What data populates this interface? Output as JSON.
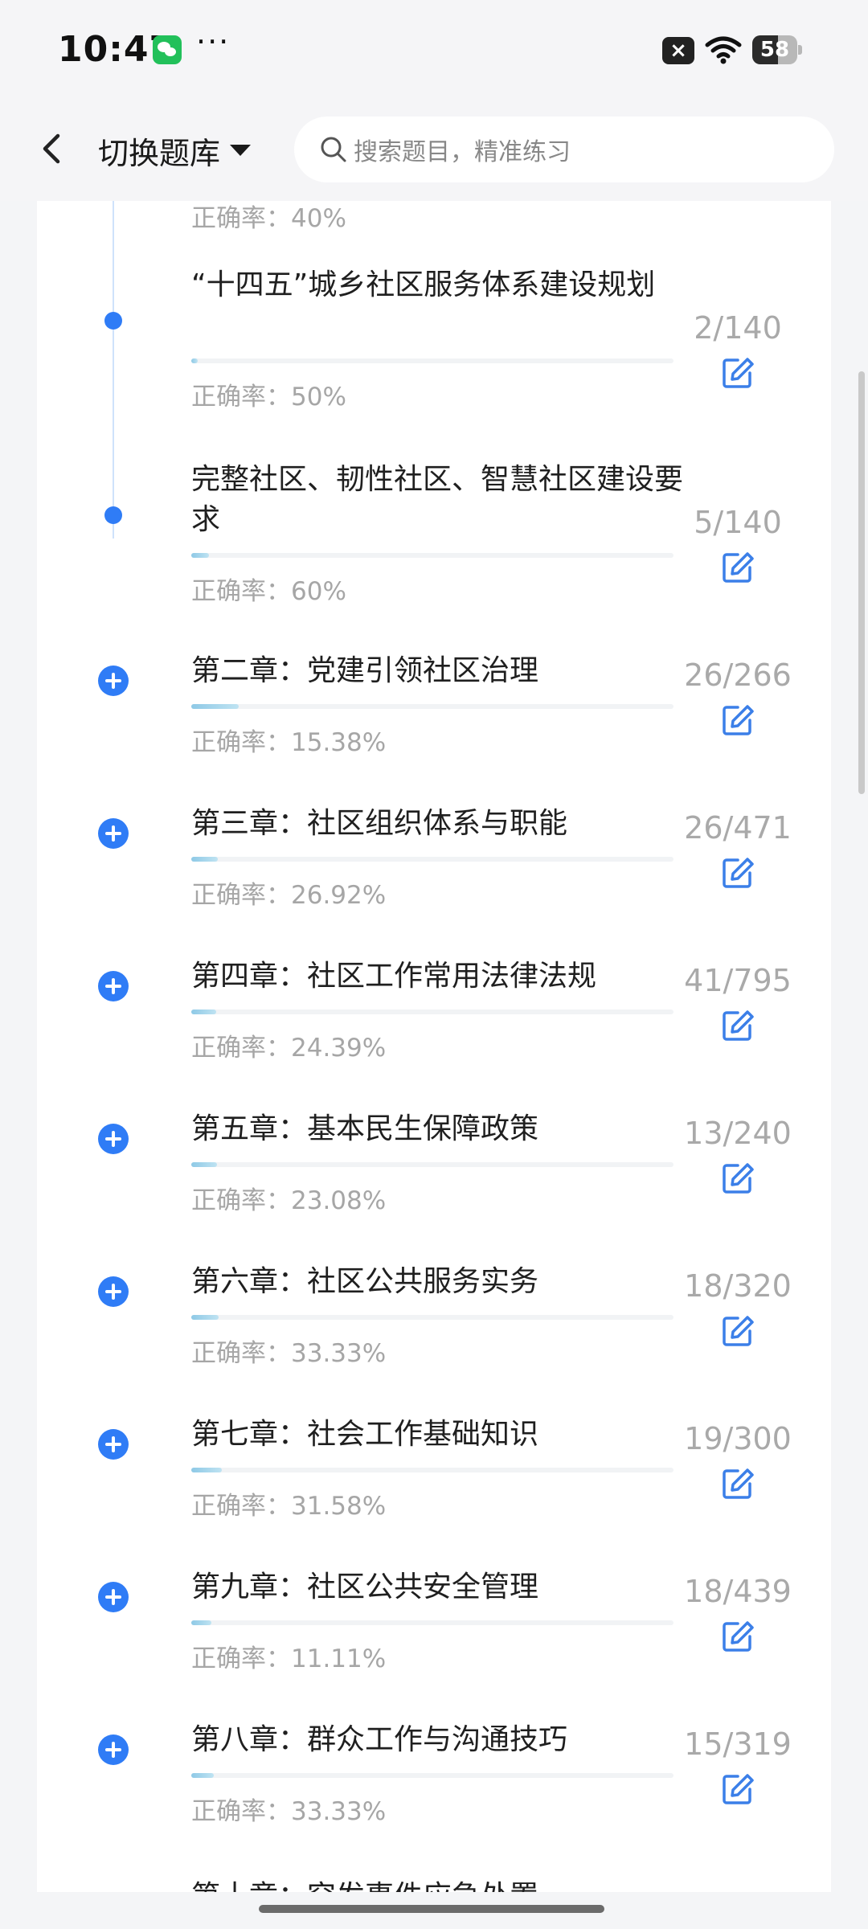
{
  "status_bar": {
    "time": "10:47",
    "more": "···",
    "battery_level": "58",
    "battery_fraction": 0.58,
    "icons": [
      "wechat-icon",
      "sim-x-icon",
      "wifi-icon",
      "battery-icon"
    ]
  },
  "header": {
    "back_icon": "chevron-left-icon",
    "switch_label": "切换题库",
    "search_placeholder": "搜索题目，精准练习"
  },
  "colors": {
    "accent": "#2f7cf6",
    "progress": "#8ec9e6",
    "muted_text": "#a6a6a6"
  },
  "list": {
    "partial_top": "正确率：40%",
    "partial_bottom": "第十章：突发事件应急处置",
    "items": [
      {
        "title": "“十四五”城乡社区服务体系建设规划",
        "accuracy": "正确率：50%",
        "count": "2/140",
        "progress": 0.014,
        "marker": "dot"
      },
      {
        "title": "完整社区、韧性社区、智慧社区建设要求",
        "accuracy": "正确率：60%",
        "count": "5/140",
        "progress": 0.036,
        "marker": "dot"
      },
      {
        "title": "第二章：党建引领社区治理",
        "accuracy": "正确率：15.38%",
        "count": "26/266",
        "progress": 0.098,
        "marker": "plus"
      },
      {
        "title": "第三章：社区组织体系与职能",
        "accuracy": "正确率：26.92%",
        "count": "26/471",
        "progress": 0.055,
        "marker": "plus"
      },
      {
        "title": "第四章：社区工作常用法律法规",
        "accuracy": "正确率：24.39%",
        "count": "41/795",
        "progress": 0.052,
        "marker": "plus"
      },
      {
        "title": "第五章：基本民生保障政策",
        "accuracy": "正确率：23.08%",
        "count": "13/240",
        "progress": 0.054,
        "marker": "plus"
      },
      {
        "title": "第六章：社区公共服务实务",
        "accuracy": "正确率：33.33%",
        "count": "18/320",
        "progress": 0.056,
        "marker": "plus"
      },
      {
        "title": "第七章：社会工作基础知识",
        "accuracy": "正确率：31.58%",
        "count": "19/300",
        "progress": 0.063,
        "marker": "plus"
      },
      {
        "title": "第九章：社区公共安全管理",
        "accuracy": "正确率：11.11%",
        "count": "18/439",
        "progress": 0.041,
        "marker": "plus"
      },
      {
        "title": "第八章：群众工作与沟通技巧",
        "accuracy": "正确率：33.33%",
        "count": "15/319",
        "progress": 0.047,
        "marker": "plus"
      }
    ]
  }
}
